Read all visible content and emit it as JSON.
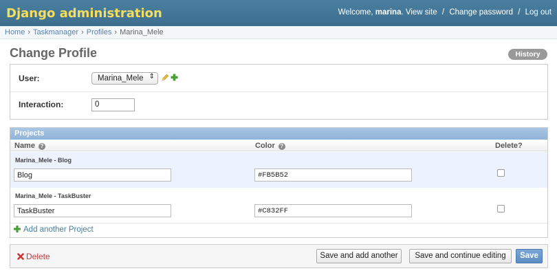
{
  "header": {
    "branding": "Django administration",
    "welcome": "Welcome,",
    "username": "marina",
    "links": [
      "View site",
      "Change password",
      "Log out"
    ]
  },
  "breadcrumbs": [
    "Home",
    "Taskmanager",
    "Profiles",
    "Marina_Mele"
  ],
  "page": {
    "title": "Change Profile",
    "history": "History"
  },
  "form": {
    "user_label": "User:",
    "user_value": "Marina_Mele",
    "interaction_label": "Interaction:",
    "interaction_value": "0"
  },
  "inline": {
    "caption": "Projects",
    "columns": [
      "Name",
      "Color",
      "Delete?"
    ],
    "rows": [
      {
        "title": "Marina_Mele - Blog",
        "name": "Blog",
        "color": "#FB5B52",
        "delete": false
      },
      {
        "title": "Marina_Mele - TaskBuster",
        "name": "TaskBuster",
        "color": "#C832FF",
        "delete": false
      }
    ],
    "add_label": "Add another Project"
  },
  "submit": {
    "delete": "Delete",
    "save_add_another": "Save and add another",
    "save_continue": "Save and continue editing",
    "save": "Save"
  },
  "colors": {
    "header_bg": "#417690",
    "branding": "#f5dd5d",
    "link": "#447e9b",
    "delete": "#cc3434",
    "caption_bg": "#a9c6e4",
    "row_highlight": "#edf3fe"
  }
}
